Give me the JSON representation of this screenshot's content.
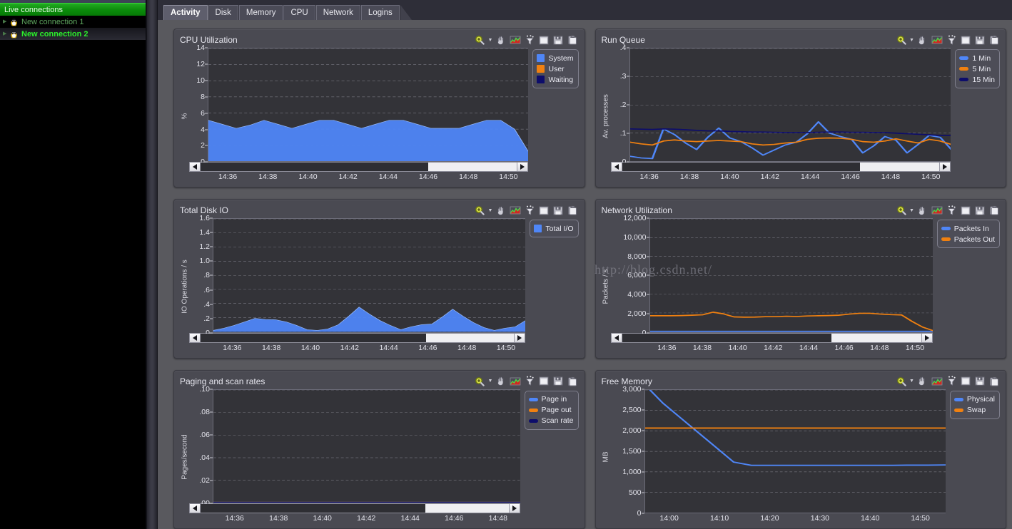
{
  "sidebar": {
    "header": "Live connections",
    "items": [
      {
        "label": "New connection 1",
        "icon": "tux-icon",
        "selected": false
      },
      {
        "label": "New connection 2",
        "icon": "tux-icon",
        "selected": true
      }
    ]
  },
  "tabs": [
    {
      "label": "Activity",
      "active": true
    },
    {
      "label": "Disk",
      "active": false
    },
    {
      "label": "Memory",
      "active": false
    },
    {
      "label": "CPU",
      "active": false
    },
    {
      "label": "Network",
      "active": false
    },
    {
      "label": "Logins",
      "active": false
    }
  ],
  "panel_tools": [
    {
      "name": "zoom-icon",
      "label": "Zoom"
    },
    {
      "name": "zoom-dropdown-caret-icon",
      "label": "Zoom options"
    },
    {
      "name": "pan-hand-icon",
      "label": "Pan"
    },
    {
      "name": "chart-type-icon",
      "label": "Chart type"
    },
    {
      "name": "filter-icon",
      "label": "Filter"
    },
    {
      "name": "maximize-window-icon",
      "label": "Maximize"
    },
    {
      "name": "save-disk-icon",
      "label": "Save"
    },
    {
      "name": "copy-clipboard-icon",
      "label": "Copy"
    }
  ],
  "watermark": "http://blog.csdn.net/",
  "colors": {
    "series_blue": "#4f86f7",
    "series_orange": "#f08010",
    "series_navy": "#0d0d6b",
    "plot_bg": "#333338",
    "panel_bg": "#4a4a52",
    "app_bg": "#59595e",
    "accent_green": "#2bf02b"
  },
  "chart_data": [
    {
      "id": "cpu-utilization",
      "type": "area",
      "title": "CPU Utilization",
      "ylabel": "%",
      "xlabel": "",
      "ylim": [
        0,
        14
      ],
      "yticks": [
        0,
        2,
        4,
        6,
        8,
        10,
        12,
        14
      ],
      "xticks": [
        "14:36",
        "14:38",
        "14:40",
        "14:42",
        "14:44",
        "14:46",
        "14:48",
        "14:50"
      ],
      "grid": true,
      "legend_position": "right",
      "legend_style": "box",
      "series": [
        {
          "name": "System",
          "color": "#4f86f7",
          "values": [
            5.1,
            4.6,
            4.1,
            4.5,
            5.1,
            4.6,
            4.1,
            4.6,
            5.1,
            5.1,
            4.6,
            4.1,
            4.6,
            5.1,
            5.1,
            4.6,
            4.1,
            4.1,
            4.1,
            4.6,
            5.1,
            5.1,
            4.0,
            1.2
          ]
        },
        {
          "name": "User",
          "color": "#f08010",
          "values": [
            0,
            0,
            0,
            0,
            0,
            0,
            0,
            0,
            0,
            0,
            0,
            0,
            0,
            0,
            0,
            0,
            0,
            0,
            0,
            0,
            0,
            0,
            0,
            0
          ]
        },
        {
          "name": "Waiting",
          "color": "#0d0d6b",
          "values": [
            0,
            0,
            0,
            0,
            0,
            0,
            0,
            0,
            0,
            0,
            0,
            0,
            0,
            0,
            0,
            0,
            0,
            0,
            0,
            0,
            0,
            0,
            0,
            0
          ]
        }
      ],
      "scroll": {
        "thumb_start_pct": 0,
        "thumb_width_pct": 72
      }
    },
    {
      "id": "run-queue",
      "type": "line",
      "title": "Run Queue",
      "ylabel": "Av. processes",
      "xlabel": "",
      "ylim": [
        0,
        0.4
      ],
      "yticks": [
        ".0",
        ".1",
        ".2",
        ".3",
        ".4"
      ],
      "xticks": [
        "14:36",
        "14:38",
        "14:40",
        "14:42",
        "14:44",
        "14:46",
        "14:48",
        "14:50"
      ],
      "grid": true,
      "legend_position": "right",
      "legend_style": "line",
      "series": [
        {
          "name": "1 Min",
          "color": "#4f86f7",
          "values": [
            0.018,
            0.012,
            0.01,
            0.115,
            0.095,
            0.065,
            0.042,
            0.085,
            0.118,
            0.083,
            0.07,
            0.048,
            0.022,
            0.04,
            0.058,
            0.068,
            0.098,
            0.14,
            0.1,
            0.088,
            0.078,
            0.03,
            0.055,
            0.088,
            0.075,
            0.03,
            0.06,
            0.092,
            0.085,
            0.042
          ]
        },
        {
          "name": "5 Min",
          "color": "#f08010",
          "values": [
            0.068,
            0.062,
            0.058,
            0.072,
            0.076,
            0.072,
            0.07,
            0.072,
            0.074,
            0.072,
            0.07,
            0.062,
            0.058,
            0.06,
            0.065,
            0.068,
            0.078,
            0.082,
            0.083,
            0.082,
            0.078,
            0.07,
            0.068,
            0.072,
            0.08,
            0.072,
            0.065,
            0.078,
            0.072,
            0.06
          ]
        },
        {
          "name": "15 Min",
          "color": "#0d0d6b",
          "values": [
            0.115,
            0.114,
            0.113,
            0.115,
            0.114,
            0.112,
            0.11,
            0.108,
            0.108,
            0.106,
            0.105,
            0.104,
            0.104,
            0.103,
            0.102,
            0.102,
            0.102,
            0.103,
            0.104,
            0.104,
            0.103,
            0.103,
            0.102,
            0.102,
            0.1,
            0.098,
            0.096,
            0.094,
            0.092,
            0.092
          ]
        }
      ],
      "scroll": {
        "thumb_start_pct": 0,
        "thumb_width_pct": 75
      }
    },
    {
      "id": "total-disk-io",
      "type": "area",
      "title": "Total Disk IO",
      "ylabel": "IO Operations / s",
      "xlabel": "",
      "ylim": [
        0,
        1.6
      ],
      "yticks": [
        ".0",
        ".2",
        ".4",
        ".6",
        ".8",
        "1.0",
        "1.2",
        "1.4",
        "1.6"
      ],
      "xticks": [
        "14:36",
        "14:38",
        "14:40",
        "14:42",
        "14:44",
        "14:46",
        "14:48",
        "14:50"
      ],
      "grid": true,
      "legend_position": "right",
      "legend_style": "box",
      "series": [
        {
          "name": "Total I/O",
          "color": "#4f86f7",
          "values": [
            0.02,
            0.05,
            0.09,
            0.14,
            0.19,
            0.175,
            0.17,
            0.14,
            0.09,
            0.03,
            0.02,
            0.04,
            0.1,
            0.22,
            0.35,
            0.25,
            0.16,
            0.09,
            0.03,
            0.07,
            0.1,
            0.11,
            0.21,
            0.32,
            0.22,
            0.13,
            0.06,
            0.02,
            0.05,
            0.07,
            0.16
          ]
        }
      ],
      "scroll": {
        "thumb_start_pct": 0,
        "thumb_width_pct": 72
      }
    },
    {
      "id": "network-utilization",
      "type": "line",
      "title": "Network Utilization",
      "ylabel": "Packets / s",
      "xlabel": "",
      "ylim": [
        0,
        12000
      ],
      "yticks": [
        "0",
        "2,000",
        "4,000",
        "6,000",
        "8,000",
        "10,000",
        "12,000"
      ],
      "xticks": [
        "14:36",
        "14:38",
        "14:40",
        "14:42",
        "14:44",
        "14:46",
        "14:48",
        "14:50"
      ],
      "grid": true,
      "legend_position": "right",
      "legend_style": "line",
      "series": [
        {
          "name": "Packets In",
          "color": "#4f86f7",
          "values": [
            0,
            0,
            0,
            0,
            0,
            0,
            0,
            0,
            0,
            0,
            0,
            0,
            0,
            0,
            0,
            0,
            0,
            0,
            0,
            0,
            0,
            0,
            0,
            0,
            0,
            0
          ]
        },
        {
          "name": "Packets Out",
          "color": "#f08010",
          "values": [
            1700,
            1700,
            1700,
            1720,
            1760,
            1800,
            2080,
            1900,
            1580,
            1550,
            1560,
            1600,
            1600,
            1650,
            1620,
            1680,
            1700,
            1720,
            1760,
            1880,
            1960,
            1960,
            1880,
            1820,
            1790,
            1100,
            500,
            120
          ]
        }
      ],
      "scroll": {
        "thumb_start_pct": 0,
        "thumb_width_pct": 70
      }
    },
    {
      "id": "paging-and-scan-rates",
      "type": "line",
      "title": "Paging and scan rates",
      "ylabel": "Pages/second",
      "xlabel": "",
      "ylim": [
        0,
        0.1
      ],
      "yticks": [
        ".00",
        ".02",
        ".04",
        ".06",
        ".08",
        ".10"
      ],
      "xticks": [
        "14:36",
        "14:38",
        "14:40",
        "14:42",
        "14:44",
        "14:46",
        "14:48"
      ],
      "grid": true,
      "legend_position": "right",
      "legend_style": "line",
      "series": [
        {
          "name": "Page in",
          "color": "#4f86f7",
          "values": [
            0,
            0,
            0,
            0,
            0,
            0,
            0,
            0,
            0,
            0,
            0,
            0
          ]
        },
        {
          "name": "Page out",
          "color": "#f08010",
          "values": [
            0,
            0,
            0,
            0,
            0,
            0,
            0,
            0,
            0,
            0,
            0,
            0
          ]
        },
        {
          "name": "Scan rate",
          "color": "#0d0d6b",
          "values": [
            0,
            0,
            0,
            0,
            0,
            0,
            0,
            0,
            0,
            0,
            0,
            0
          ]
        }
      ],
      "scroll": {
        "thumb_start_pct": 0,
        "thumb_width_pct": 73
      }
    },
    {
      "id": "free-memory",
      "type": "line",
      "title": "Free Memory",
      "ylabel": "MB",
      "xlabel": "",
      "ylim": [
        0,
        3000
      ],
      "yticks": [
        "0",
        "500",
        "1,000",
        "1,500",
        "2,000",
        "2,500",
        "3,000"
      ],
      "xticks": [
        "14:00",
        "14:10",
        "14:20",
        "14:30",
        "14:40",
        "14:50"
      ],
      "grid": true,
      "legend_position": "right",
      "legend_style": "line",
      "has_scrollbar": false,
      "series": [
        {
          "name": "Physical",
          "color": "#4f86f7",
          "values": [
            3120,
            2680,
            2320,
            1960,
            1600,
            1240,
            1160,
            1160,
            1160,
            1160,
            1160,
            1160,
            1160,
            1160,
            1160,
            1165,
            1165,
            1170
          ]
        },
        {
          "name": "Swap",
          "color": "#f08010",
          "values": [
            2070,
            2070,
            2070,
            2070,
            2070,
            2070,
            2070,
            2070,
            2070,
            2070,
            2070,
            2070,
            2070,
            2070,
            2070,
            2070,
            2070,
            2070
          ]
        }
      ]
    }
  ]
}
